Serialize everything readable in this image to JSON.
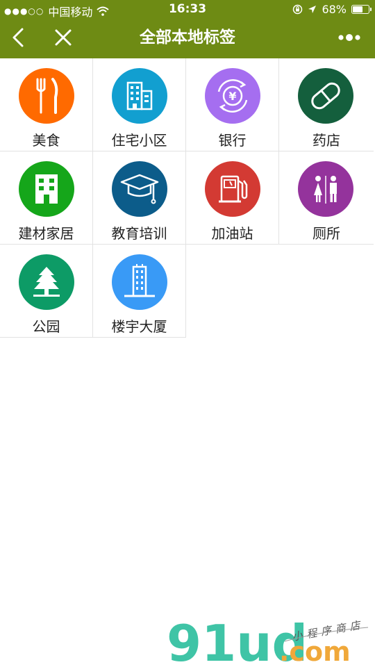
{
  "status_bar": {
    "signal": "●●●○○",
    "carrier": "中国移动",
    "time": "16:33",
    "battery_percent": "68%",
    "battery_level": 0.68
  },
  "nav": {
    "title": "全部本地标签",
    "icons": [
      "back-arrow-icon",
      "close-icon",
      "more-dots-icon"
    ]
  },
  "categories": [
    {
      "label": "美食",
      "icon": "fork-knife-icon",
      "color": "#ff6a00"
    },
    {
      "label": "住宅小区",
      "icon": "building-icon",
      "color": "#129fd0"
    },
    {
      "label": "银行",
      "icon": "yuan-exchange-icon",
      "color": "#a56ef0"
    },
    {
      "label": "药店",
      "icon": "pill-icon",
      "color": "#145f3d"
    },
    {
      "label": "建材家居",
      "icon": "home-building-icon",
      "color": "#15a61a"
    },
    {
      "label": "教育培训",
      "icon": "graduation-cap-icon",
      "color": "#0c5c8a"
    },
    {
      "label": "加油站",
      "icon": "gas-pump-icon",
      "color": "#d33a33"
    },
    {
      "label": "厕所",
      "icon": "restroom-icon",
      "color": "#94339c"
    },
    {
      "label": "公园",
      "icon": "tree-icon",
      "color": "#0d9b66"
    },
    {
      "label": "楼宇大厦",
      "icon": "skyscraper-icon",
      "color": "#399af6"
    }
  ],
  "watermark": {
    "brand": "91ud",
    "domain": ".com",
    "tagline": "小程序商店"
  }
}
